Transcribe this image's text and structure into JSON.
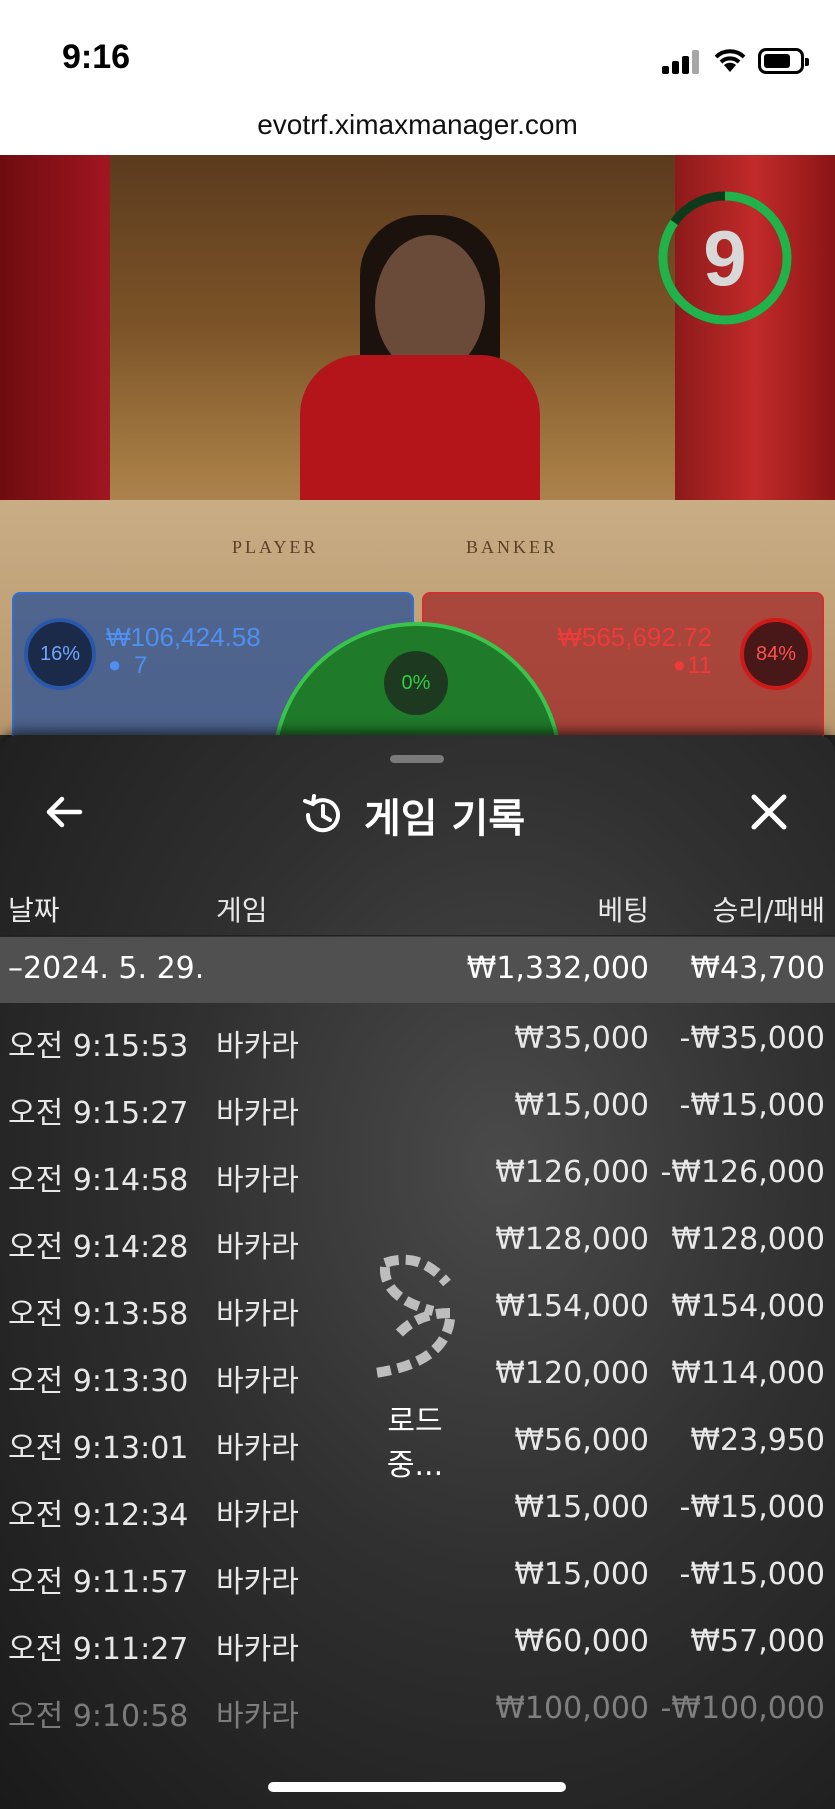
{
  "status_bar": {
    "time": "9:16"
  },
  "browser": {
    "url": "evotrf.ximaxmanager.com"
  },
  "game_view": {
    "countdown": "9",
    "table_labels": {
      "player": "PLAYER",
      "banker": "BANKER"
    },
    "player_bet": {
      "percent": "16%",
      "amount": "₩106,424.58",
      "players": "7"
    },
    "banker_bet": {
      "percent": "84%",
      "amount": "₩565,692.72",
      "players": "11"
    },
    "tie_bet": {
      "percent": "0%"
    }
  },
  "history": {
    "title": "게임 기록",
    "columns": {
      "date": "날짜",
      "game": "게임",
      "bet": "베팅",
      "result": "승리/패배"
    },
    "date_group": {
      "date": "–2024. 5. 29.",
      "bet_total": "₩1,332,000",
      "result_total": "₩43,700"
    },
    "rows": [
      {
        "time": "오전 9:15:53",
        "game": "바카라",
        "bet": "₩35,000",
        "result": "-₩35,000"
      },
      {
        "time": "오전 9:15:27",
        "game": "바카라",
        "bet": "₩15,000",
        "result": "-₩15,000"
      },
      {
        "time": "오전 9:14:58",
        "game": "바카라",
        "bet": "₩126,000",
        "result": "-₩126,000"
      },
      {
        "time": "오전 9:14:28",
        "game": "바카라",
        "bet": "₩128,000",
        "result": "₩128,000"
      },
      {
        "time": "오전 9:13:58",
        "game": "바카라",
        "bet": "₩154,000",
        "result": "₩154,000"
      },
      {
        "time": "오전 9:13:30",
        "game": "바카라",
        "bet": "₩120,000",
        "result": "₩114,000"
      },
      {
        "time": "오전 9:13:01",
        "game": "바카라",
        "bet": "₩56,000",
        "result": "₩23,950"
      },
      {
        "time": "오전 9:12:34",
        "game": "바카라",
        "bet": "₩15,000",
        "result": "-₩15,000"
      },
      {
        "time": "오전 9:11:57",
        "game": "바카라",
        "bet": "₩15,000",
        "result": "-₩15,000"
      },
      {
        "time": "오전 9:11:27",
        "game": "바카라",
        "bet": "₩60,000",
        "result": "₩57,000"
      },
      {
        "time": "오전 9:10:58",
        "game": "바카라",
        "bet": "₩100,000",
        "result": "-₩100,000"
      }
    ],
    "loading_text": "로드 중..."
  },
  "icons": [
    "back-arrow-icon",
    "history-clock-icon",
    "close-icon",
    "loading-spinner-icon",
    "signal-icon",
    "wifi-icon",
    "battery-icon",
    "person-icon"
  ],
  "colors": {
    "player_blue": "#3070d0",
    "banker_red": "#d03030",
    "tie_green": "#39c54b",
    "timer_green": "#22b24c"
  }
}
